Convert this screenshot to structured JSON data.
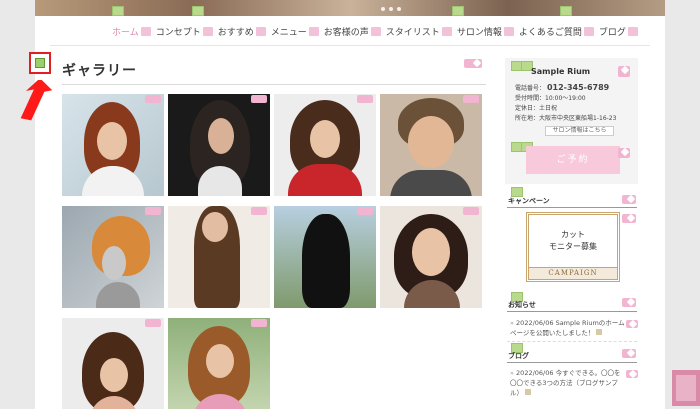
{
  "nav": {
    "items": [
      {
        "label": "ホーム",
        "active": true
      },
      {
        "label": "コンセプト"
      },
      {
        "label": "おすすめ"
      },
      {
        "label": "メニュー"
      },
      {
        "label": "お客様の声"
      },
      {
        "label": "スタイリスト"
      },
      {
        "label": "サロン情報"
      },
      {
        "label": "よくあるご質問"
      },
      {
        "label": "ブログ"
      }
    ]
  },
  "main": {
    "title": "ギャラリー"
  },
  "sidebar": {
    "salon_name": "Sample Rium",
    "phone_label": "電話番号：",
    "phone": "012-345-6789",
    "hours_label": "受付時間：",
    "hours": "10:00～19:00",
    "closed_label": "定休日：",
    "closed": "土日祝",
    "address_label": "所在地：",
    "address": "大阪市中央区東船場1-16-23",
    "salon_link": "サロン情報はこちら",
    "reserve_button": "ご予約",
    "campaign_heading": "キャンペーン",
    "campaign_line1": "カット",
    "campaign_line2": "モニター募集",
    "campaign_band": "CAMPAIGN",
    "news_heading": "お知らせ",
    "news_item": "2022/06/06 Sample Riumのホームページを公開いたしました！",
    "blog_heading": "ブログ",
    "blog_item": "2022/06/06 今すぐできる。〇〇を〇〇できる3つの方法（ブログサンプル）"
  },
  "colors": {
    "accent_pink": "#f1b5d2",
    "edit_green": "#b9d98d",
    "marker_red": "#e02020"
  },
  "icons": {
    "edit": "pencil-icon",
    "marker": "green-square-icon",
    "arrow": "red-arrow-icon"
  }
}
